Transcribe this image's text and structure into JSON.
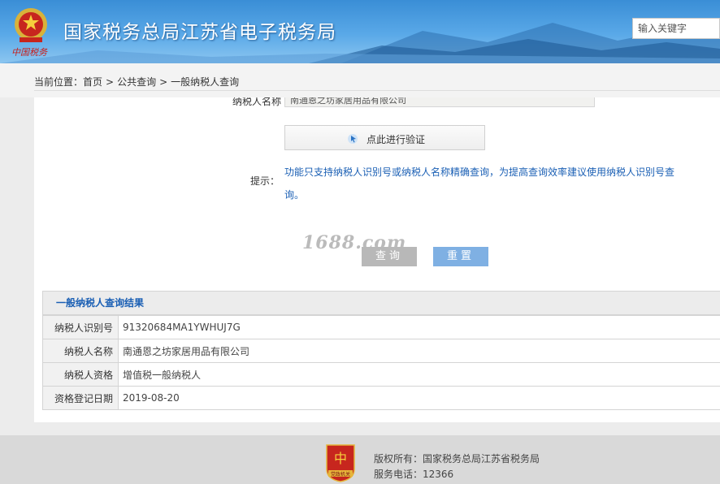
{
  "header": {
    "site_title": "国家税务总局江苏省电子税务局",
    "brand_script": "中国税务",
    "search_placeholder": "输入关键字"
  },
  "breadcrumb": {
    "prefix": "当前位置：",
    "items": [
      "首页",
      "公共查询",
      "一般纳税人查询"
    ],
    "separator": ">"
  },
  "form": {
    "name_label": "纳税人名称",
    "name_value": "南通恩之坊家居用品有限公司",
    "verify_label": "点此进行验证",
    "tip_label": "提示：",
    "tip_text": "功能只支持纳税人识别号或纳税人名称精确查询，为提高查询效率建议使用纳税人识别号查询。",
    "query_label": "查询",
    "reset_label": "重置"
  },
  "watermark": "1688.com",
  "results": {
    "title": "一般纳税人查询结果",
    "rows": [
      {
        "key": "纳税人识别号",
        "value": "91320684MA1YWHUJ7G"
      },
      {
        "key": "纳税人名称",
        "value": "南通恩之坊家居用品有限公司"
      },
      {
        "key": "纳税人资格",
        "value": "增值税一般纳税人"
      },
      {
        "key": "资格登记日期",
        "value": "2019-08-20"
      }
    ]
  },
  "footer": {
    "badge_text": "党政机关",
    "copyright": "版权所有：国家税务总局江苏省税务局",
    "phone": "服务电话：12366"
  },
  "colors": {
    "header_blue": "#3a8ed6",
    "link_blue": "#1a5fb4",
    "reset_button": "#7fb0e3",
    "query_button": "#b8b8b8"
  }
}
